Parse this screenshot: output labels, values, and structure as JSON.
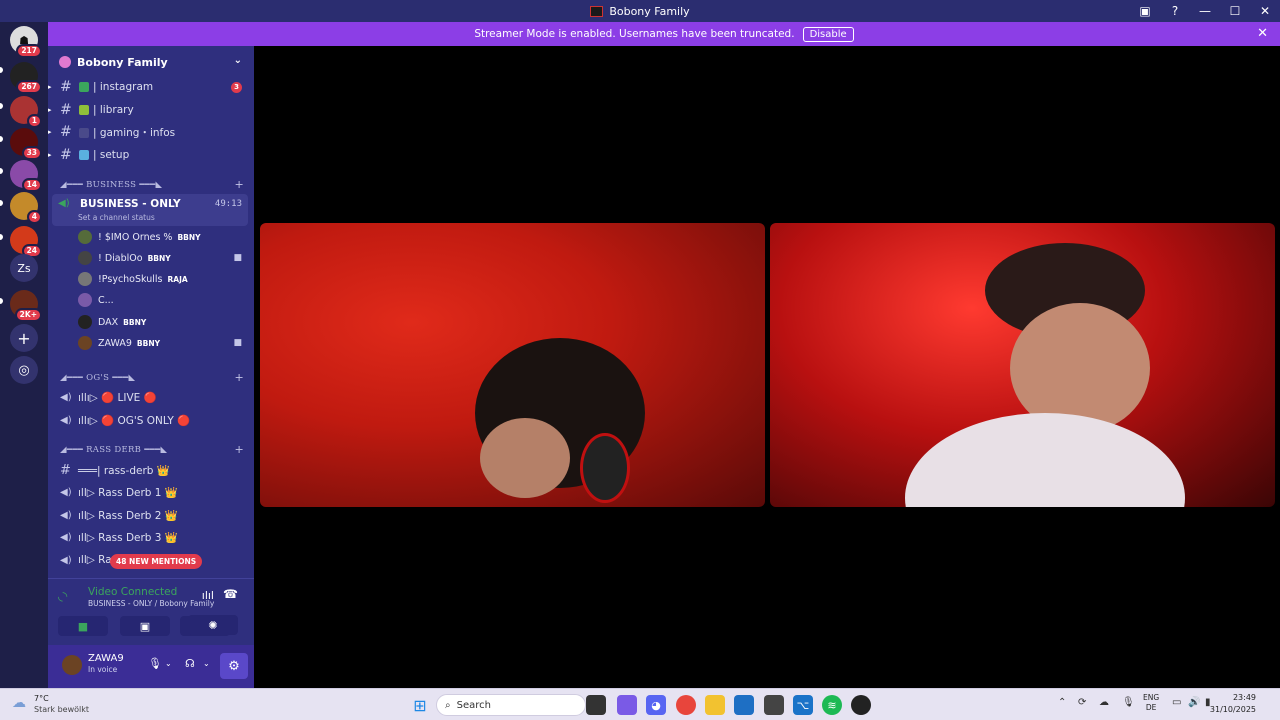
{
  "window": {
    "title": "Bobony Family"
  },
  "streamer_banner": {
    "text": "Streamer Mode is enabled. Usernames have been truncated.",
    "disable_label": "Disable"
  },
  "guilds": [
    {
      "badge": "217"
    },
    {
      "badge": "267"
    },
    {
      "badge": "1"
    },
    {
      "badge": "33"
    },
    {
      "badge": "14"
    },
    {
      "badge": "4"
    },
    {
      "badge": "24"
    },
    {
      "label": "Zs"
    },
    {
      "badge": "2K+"
    }
  ],
  "server": {
    "name": "Bobony Family"
  },
  "channels": [
    {
      "label": "| instagram",
      "badge": "3"
    },
    {
      "label": "| library"
    },
    {
      "label": "| gaming・infos"
    },
    {
      "label": "| setup"
    }
  ],
  "categories": {
    "business": "◢━━━ BUSINESS ━━━◣",
    "ogs": "◢━━━ OG'S ━━━◣",
    "rass": "◢━━━ RASS DERB ━━━◣"
  },
  "active_channel": {
    "name": "BUSINESS - ONLY",
    "time": "49:13",
    "status": "Set a channel status"
  },
  "voice_users": [
    {
      "name": "! $IMO Ornes %",
      "tag": "BBNY"
    },
    {
      "name": "! DiablOo",
      "tag": "BBNY"
    },
    {
      "name": "!PsychoSkulls",
      "tag": "RAJA"
    },
    {
      "name": "C...",
      "tag": ""
    },
    {
      "name": "DAX",
      "tag": "BBNY"
    },
    {
      "name": "ZAWA9",
      "tag": "BBNY"
    }
  ],
  "og_channels": [
    {
      "label": "ıllı▷ 🔴 LIVE 🔴"
    },
    {
      "label": "ıllı▷ 🔴 OG'S ONLY 🔴"
    }
  ],
  "rass_channels": [
    {
      "label": "═══| rass-derb 👑"
    },
    {
      "label": "ıll▷ Rass Derb 1 👑"
    },
    {
      "label": "ıll▷ Rass Derb 2 👑"
    },
    {
      "label": "ıll▷ Rass Derb 3 👑"
    },
    {
      "label": "ıll▷ Ras"
    }
  ],
  "mentions_pill": "48 NEW MENTIONS",
  "voice_panel": {
    "title": "Video Connected",
    "subtitle": "BUSINESS - ONLY / Bobony Family"
  },
  "user_panel": {
    "name": "ZAWA9",
    "status": "In voice"
  },
  "taskbar": {
    "temp": "7°C",
    "condition": "Stark bewölkt",
    "search_placeholder": "Search",
    "lang1": "ENG",
    "lang2": "DE",
    "time": "23:49",
    "date": "31/10/2025"
  },
  "colors": {
    "accent": "#8c3ee6",
    "sidebar": "#2f2f7e",
    "mention": "#e23b4c",
    "connected": "#3ba55d"
  }
}
